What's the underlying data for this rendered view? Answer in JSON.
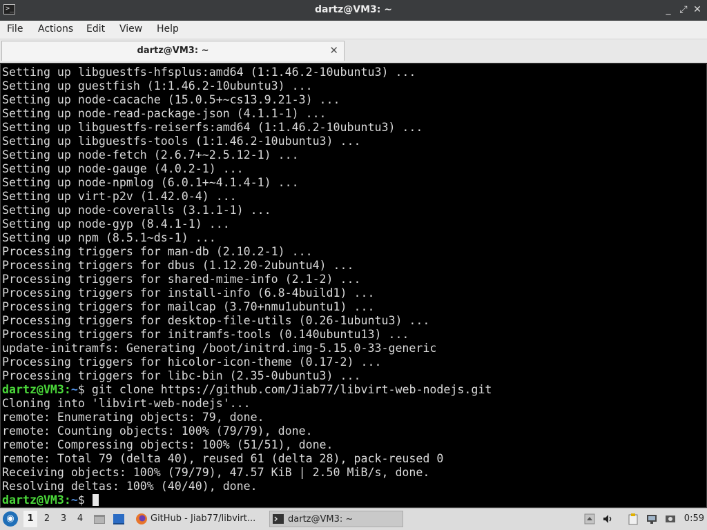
{
  "window": {
    "title": "dartz@VM3: ~",
    "minimize_glyph": "_",
    "maximize_glyph": "⤢",
    "close_glyph": "✕"
  },
  "menu": {
    "items": [
      "File",
      "Actions",
      "Edit",
      "View",
      "Help"
    ]
  },
  "tabs": [
    {
      "label": "dartz@VM3: ~",
      "close_glyph": "✕"
    }
  ],
  "terminal": {
    "lines": [
      "Setting up libguestfs-hfsplus:amd64 (1:1.46.2-10ubuntu3) ...",
      "Setting up guestfish (1:1.46.2-10ubuntu3) ...",
      "Setting up node-cacache (15.0.5+~cs13.9.21-3) ...",
      "Setting up node-read-package-json (4.1.1-1) ...",
      "Setting up libguestfs-reiserfs:amd64 (1:1.46.2-10ubuntu3) ...",
      "Setting up libguestfs-tools (1:1.46.2-10ubuntu3) ...",
      "Setting up node-fetch (2.6.7+~2.5.12-1) ...",
      "Setting up node-gauge (4.0.2-1) ...",
      "Setting up node-npmlog (6.0.1+~4.1.4-1) ...",
      "Setting up virt-p2v (1.42.0-4) ...",
      "Setting up node-coveralls (3.1.1-1) ...",
      "Setting up node-gyp (8.4.1-1) ...",
      "Setting up npm (8.5.1~ds-1) ...",
      "Processing triggers for man-db (2.10.2-1) ...",
      "Processing triggers for dbus (1.12.20-2ubuntu4) ...",
      "Processing triggers for shared-mime-info (2.1-2) ...",
      "Processing triggers for install-info (6.8-4build1) ...",
      "Processing triggers for mailcap (3.70+nmu1ubuntu1) ...",
      "Processing triggers for desktop-file-utils (0.26-1ubuntu3) ...",
      "Processing triggers for initramfs-tools (0.140ubuntu13) ...",
      "update-initramfs: Generating /boot/initrd.img-5.15.0-33-generic",
      "Processing triggers for hicolor-icon-theme (0.17-2) ...",
      "Processing triggers for libc-bin (2.35-0ubuntu3) ...",
      {
        "prompt_user": "dartz@VM3",
        "prompt_sep": ":",
        "prompt_path": "~",
        "prompt_end": "$ ",
        "command": "git clone https://github.com/Jiab77/libvirt-web-nodejs.git"
      },
      "Cloning into 'libvirt-web-nodejs'...",
      "remote: Enumerating objects: 79, done.",
      "remote: Counting objects: 100% (79/79), done.",
      "remote: Compressing objects: 100% (51/51), done.",
      "remote: Total 79 (delta 40), reused 61 (delta 28), pack-reused 0",
      "Receiving objects: 100% (79/79), 47.57 KiB | 2.50 MiB/s, done.",
      "Resolving deltas: 100% (40/40), done.",
      {
        "prompt_user": "dartz@VM3",
        "prompt_sep": ":",
        "prompt_path": "~",
        "prompt_end": "$ ",
        "command": "",
        "cursor": true
      }
    ],
    "colors": {
      "prompt_user": "#4bd93a",
      "prompt_path": "#4f8ee0",
      "text": "#d9d9d9"
    }
  },
  "taskbar": {
    "workspaces": [
      "1",
      "2",
      "3",
      "4"
    ],
    "active_workspace": "1",
    "tasks": [
      {
        "label": "GitHub - Jiab77/libvirt...",
        "icon": "firefox-icon",
        "active": false
      },
      {
        "label": "dartz@VM3: ~",
        "icon": "terminal-icon",
        "active": true
      }
    ],
    "clock": "0:59"
  }
}
